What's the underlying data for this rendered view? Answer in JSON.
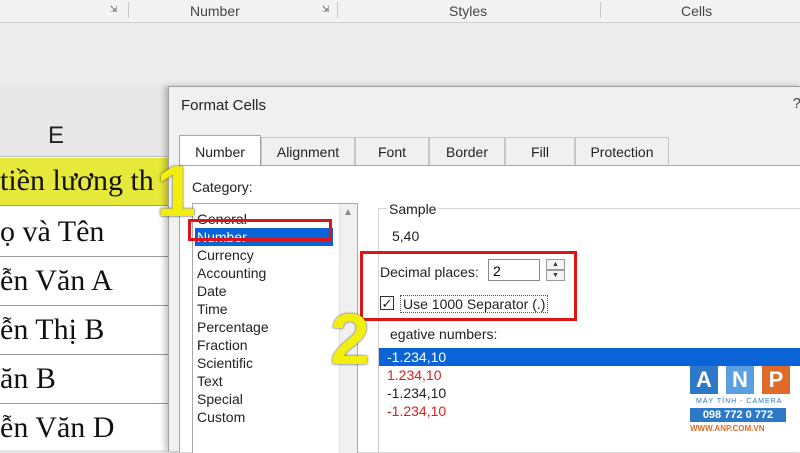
{
  "ribbon": {
    "groups": [
      "Number",
      "Styles",
      "Cells"
    ]
  },
  "sheet": {
    "column_header": "E",
    "cells": [
      "tiền lương th",
      "ọ và Tên",
      "ễn Văn A",
      "ễn Thị B",
      "ăn B",
      "ễn Văn D"
    ]
  },
  "dialog": {
    "title": "Format Cells",
    "help": "?",
    "tabs": [
      "Number",
      "Alignment",
      "Font",
      "Border",
      "Fill",
      "Protection"
    ],
    "active_tab": "Number",
    "category_label": "Category:",
    "categories": [
      "General",
      "Number",
      "Currency",
      "Accounting",
      "Date",
      "Time",
      "Percentage",
      "Fraction",
      "Scientific",
      "Text",
      "Special",
      "Custom"
    ],
    "selected_category": "Number",
    "sample_label": "Sample",
    "sample_value": "5,40",
    "decimal_places_label": "Decimal places:",
    "decimal_places_value": "2",
    "use_separator_label": "Use 1000 Separator (.)",
    "use_separator_checked": true,
    "negative_numbers_label": "egative numbers:",
    "negative_numbers": [
      {
        "text": "-1.234,10",
        "style": "selected"
      },
      {
        "text": "1.234,10",
        "style": "red"
      },
      {
        "text": "-1.234,10",
        "style": "black"
      },
      {
        "text": "-1.234,10",
        "style": "red"
      }
    ]
  },
  "annotations": {
    "step1": "1",
    "step2": "2",
    "highlight_color": "#e01418",
    "step_color": "#f2ef10"
  },
  "watermark": {
    "letters": [
      "A",
      "N",
      "P"
    ],
    "subtitle": "MÁY TÍNH - CAMERA",
    "phone": "098 772 0 772",
    "website": "WWW.ANP.COM.VN"
  }
}
